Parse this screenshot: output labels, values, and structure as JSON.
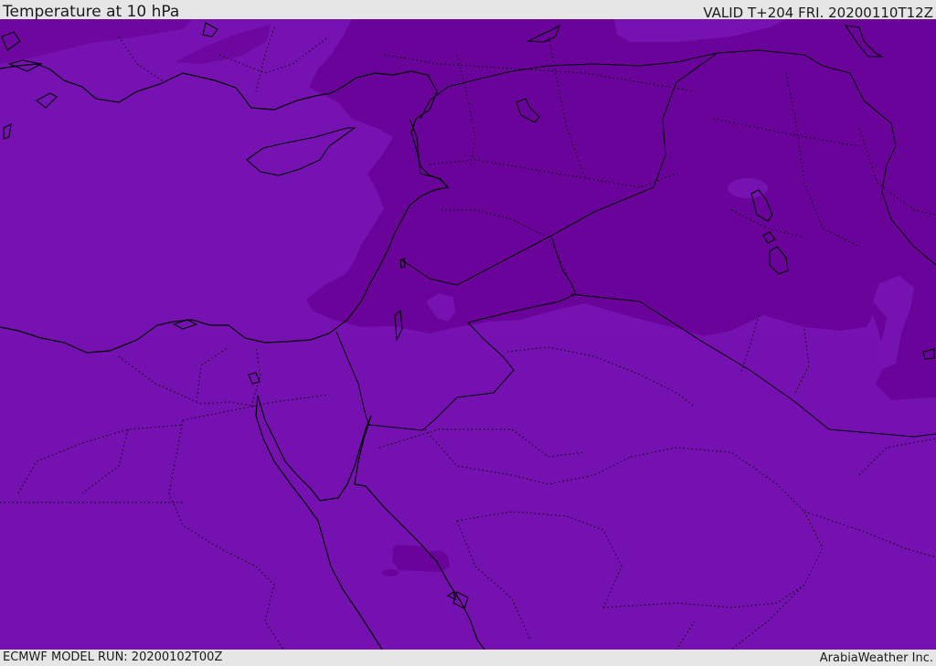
{
  "header": {
    "title": "Temperature at 10 hPa",
    "valid_time": "VALID T+204 FRI. 20200110T12Z"
  },
  "footer": {
    "model_run": "ECMWF MODEL RUN: 20200102T00Z",
    "credit": "ArabiaWeather Inc."
  },
  "map": {
    "field": "Temperature",
    "level": "10 hPa",
    "colors": {
      "base_shade": "#7612b2",
      "dark_shade": "#6a0399",
      "light_patch": "#7b18bc",
      "coastline": "#000000",
      "border": "#000000"
    }
  }
}
